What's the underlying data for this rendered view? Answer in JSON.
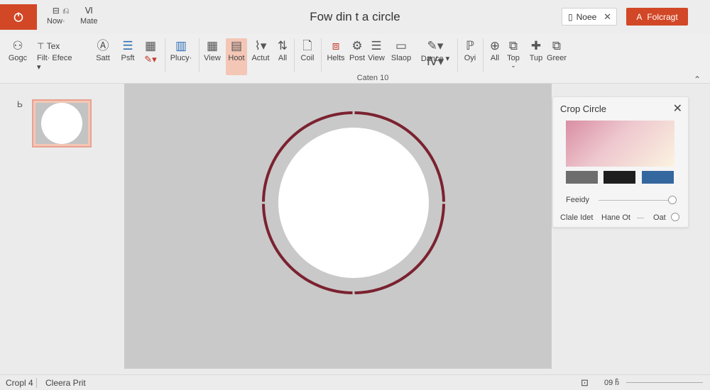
{
  "app": {
    "title": "Fow din t a circle"
  },
  "quick_access": [
    {
      "icon": "save-icon",
      "glyph": "⊟",
      "label": "Now·"
    },
    {
      "icon": "undo-icon",
      "glyph": "⎌",
      "label": ""
    },
    {
      "icon": "format-icon",
      "glyph": "Ⅵ",
      "label": "Mate"
    }
  ],
  "header": {
    "note_button": {
      "label": "Noee",
      "close": "✕"
    },
    "share_button": {
      "label": "Folcragt",
      "icon_glyph": "A"
    }
  },
  "ribbon": {
    "buttons": [
      {
        "id": "gogc",
        "icon": "person-icon",
        "glyph": "👤",
        "label": "Gogc"
      },
      {
        "id": "tex",
        "icon": "text-icon",
        "glyph": "T",
        "label": "Tex"
      },
      {
        "id": "filt",
        "icon": "filter-icon",
        "glyph": "",
        "label": "Filt·"
      },
      {
        "id": "efect",
        "icon": "effects-icon",
        "glyph": "",
        "label": "Efece ▾"
      },
      {
        "id": "satt",
        "icon": "shapes-icon",
        "glyph": "Ⓐ",
        "label": "Satt"
      },
      {
        "id": "psft",
        "icon": "align-icon",
        "glyph": "☰",
        "label": "Psft"
      },
      {
        "id": "paint",
        "icon": "paint-icon",
        "glyph": "🖌",
        "label": ""
      },
      {
        "id": "pen",
        "icon": "pen-icon",
        "glyph": "✎",
        "label": ""
      },
      {
        "id": "plucy",
        "icon": "chart-icon",
        "glyph": "▥",
        "label": "Plucy·"
      },
      {
        "id": "view",
        "icon": "grid-icon",
        "glyph": "▦",
        "label": "View"
      },
      {
        "id": "hoot",
        "icon": "table-icon",
        "glyph": "▤",
        "label": "Hoot"
      },
      {
        "id": "actut",
        "icon": "lasso-icon",
        "glyph": "⌇",
        "label": "Actut"
      },
      {
        "id": "all1",
        "icon": "arrange-icon",
        "glyph": "⇅",
        "label": "All"
      },
      {
        "id": "coil",
        "icon": "document-icon",
        "glyph": "🗋",
        "label": "Coil"
      },
      {
        "id": "helts",
        "icon": "crop-icon",
        "glyph": "⌗",
        "label": "Helts"
      },
      {
        "id": "post",
        "icon": "settings-icon",
        "glyph": "⚙",
        "label": "Post"
      },
      {
        "id": "viewb",
        "icon": "list-icon",
        "glyph": "☰",
        "label": "View"
      },
      {
        "id": "slaop",
        "icon": "slideshow-icon",
        "glyph": "▭",
        "label": "Slaop"
      },
      {
        "id": "dance",
        "icon": "draw-icon",
        "glyph": "✎",
        "label": "Dance ▾"
      },
      {
        "id": "oyi",
        "icon": "pin-icon",
        "glyph": "⚲",
        "label": "Oyi"
      },
      {
        "id": "all2",
        "icon": "search-icon",
        "glyph": "⚲",
        "label": "All"
      },
      {
        "id": "top",
        "icon": "edit-icon",
        "glyph": "✎",
        "label": "Top"
      },
      {
        "id": "tup",
        "icon": "addin-icon",
        "glyph": "✚",
        "label": "Tup"
      },
      {
        "id": "greer",
        "icon": "puzzle-icon",
        "glyph": "⧉",
        "label": "Greer"
      }
    ],
    "active_id": "hoot",
    "group_label": "Caten 10"
  },
  "slides": [
    {
      "number": "Ь"
    }
  ],
  "crop_panel": {
    "title": "Crop Circle",
    "close": "✕",
    "swatches": [
      "#6d6d6d",
      "#1e1e1e",
      "#35679f"
    ],
    "feathery_label": "Feeidy",
    "row2": {
      "label1": "Clale Idet",
      "label2": "Hane Ot",
      "label3": "Oat"
    },
    "accent": "#7b2230"
  },
  "canvas": {
    "background": "#c9c9c9",
    "ring_color": "#7b2230"
  },
  "status": {
    "slide": "Cropl 4",
    "mode": "Cleera Prit",
    "zoom": "09 ჩ"
  }
}
